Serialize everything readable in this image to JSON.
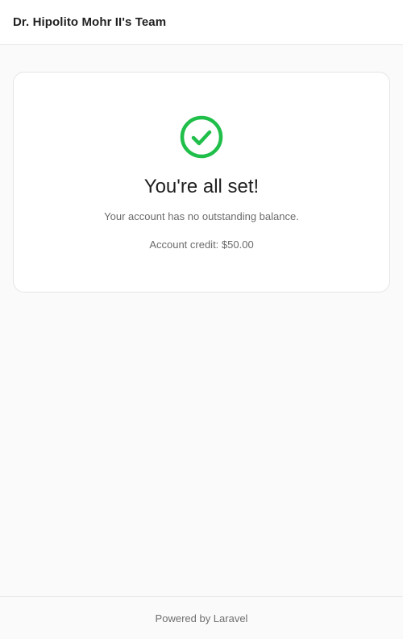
{
  "header": {
    "team_name": "Dr. Hipolito Mohr II's Team"
  },
  "status_card": {
    "icon": "check-circle-icon",
    "icon_color": "#1fbf4a",
    "title": "You're all set!",
    "message": "Your account has no outstanding balance.",
    "credit_text": "Account credit: $50.00"
  },
  "footer": {
    "powered_by": "Powered by Laravel"
  }
}
